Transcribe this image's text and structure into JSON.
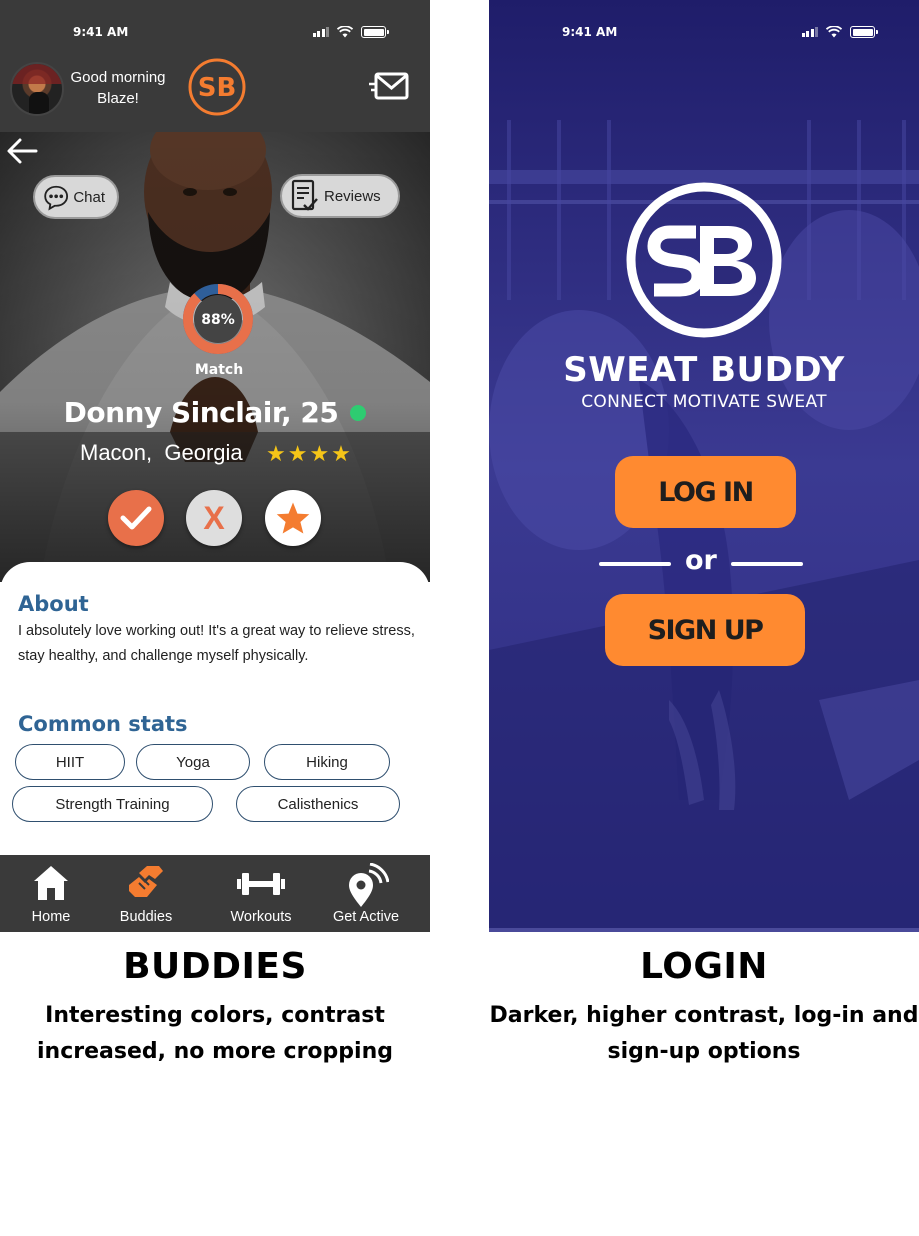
{
  "buddies_screen": {
    "status": {
      "time": "9:41 AM"
    },
    "header": {
      "greeting": "Good morning Blaze!",
      "logo_text": "SB"
    },
    "buttons": {
      "chat": "Chat",
      "reviews": "Reviews"
    },
    "match": {
      "percent": "88%",
      "label": "Match",
      "value": 0.88
    },
    "profile": {
      "name": "Donny Sinclair, 25",
      "location": "Macon,  Georgia",
      "stars": "★★★★",
      "rating": 4,
      "reject_label": "X"
    },
    "about": {
      "title": "About",
      "text": "I absolutely love working out! It's a great way to relieve stress, stay healthy, and challenge myself physically."
    },
    "common_stats": {
      "title": "Common stats",
      "tags": [
        "HIIT",
        "Yoga",
        "Hiking",
        "Strength Training",
        "Calisthenics"
      ]
    },
    "nav": [
      {
        "label": "Home",
        "icon": "home-icon"
      },
      {
        "label": "Buddies",
        "icon": "buddies-icon",
        "active": true
      },
      {
        "label": "Workouts",
        "icon": "dumbbell-icon"
      },
      {
        "label": "Get Active",
        "icon": "location-pin-icon"
      }
    ],
    "colors": {
      "accent": "#e8704a",
      "heading": "#2f6494",
      "online": "#2ecc71",
      "bar": "#3a3a3a"
    }
  },
  "login_screen": {
    "status": {
      "time": "9:41 AM"
    },
    "brand": "SWEAT BUDDY",
    "tagline": "CONNECT MOTIVATE SWEAT",
    "login_button": "LOG IN",
    "or_text": "or",
    "signup_button": "SIGN UP",
    "colors": {
      "background": "#2c2a7a",
      "button": "#ff8a30"
    }
  },
  "captions": {
    "buddies": {
      "title": "BUDDIES",
      "subtitle": "Interesting colors, contrast increased, no more cropping"
    },
    "login": {
      "title": "LOGIN",
      "subtitle": "Darker, higher contrast, log-in and sign-up options"
    }
  }
}
